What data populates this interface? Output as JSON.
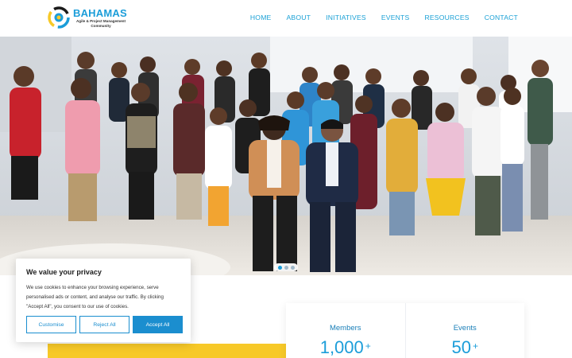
{
  "brand": {
    "title": "BAHAMAS",
    "subtitle_line1": "Agile & Project Management",
    "subtitle_line2": "Community",
    "accent": "#1b9dd9",
    "yellow": "#f7c928"
  },
  "nav": {
    "items": [
      "HOME",
      "ABOUT",
      "INITIATIVES",
      "EVENTS",
      "RESOURCES",
      "CONTACT"
    ]
  },
  "hero": {
    "image": "group-photo",
    "slider_dots": 3,
    "active_dot": 1
  },
  "stats": [
    {
      "label": "Members",
      "value": "1,000",
      "suffix": "+"
    },
    {
      "label": "Events",
      "value": "50",
      "suffix": "+"
    }
  ],
  "cookie": {
    "title": "We value your privacy",
    "text": "We use cookies to enhance your browsing experience, serve personalised ads or content, and analyse our traffic. By clicking \"Accept All\", you consent to our use of cookies.",
    "customise_label": "Customise",
    "reject_label": "Reject All",
    "accept_label": "Accept All"
  }
}
